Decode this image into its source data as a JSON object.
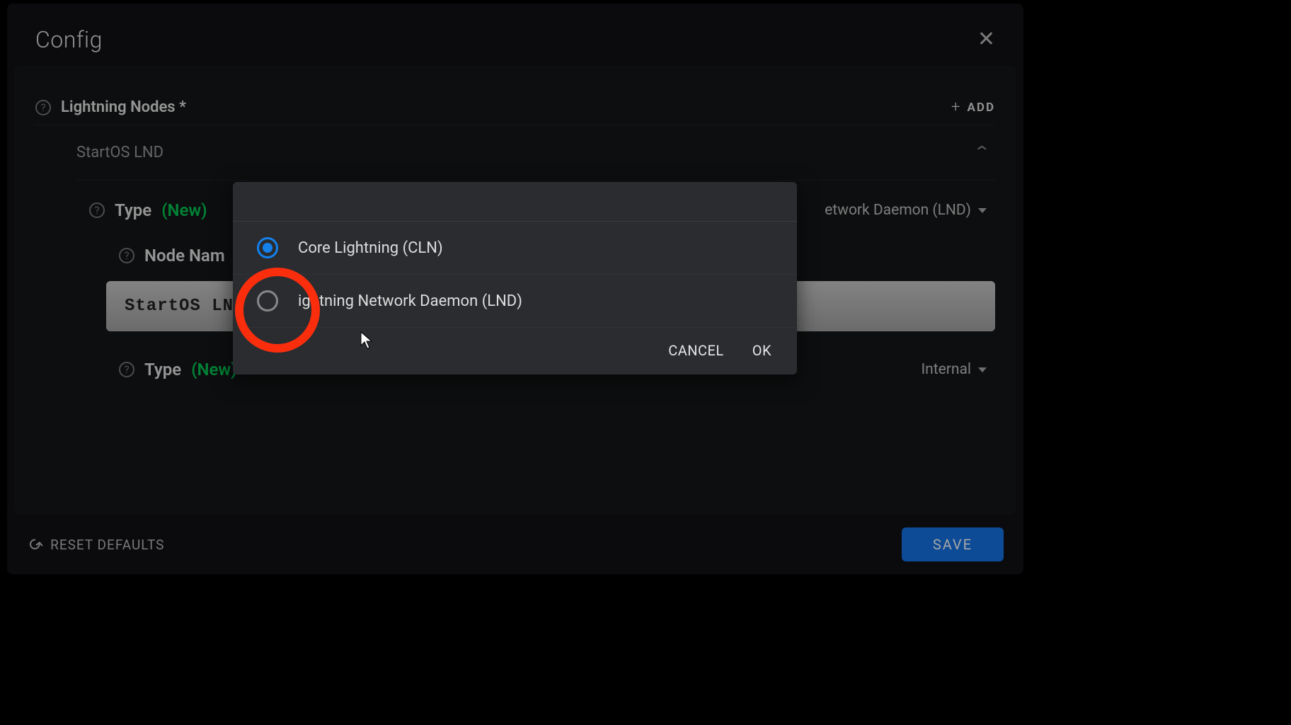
{
  "header": {
    "title": "Config"
  },
  "section": {
    "label": "Lightning Nodes *",
    "add_label": "ADD"
  },
  "node": {
    "name": "StartOS LND",
    "type_label": "Type",
    "new_tag": "(New)",
    "type_value": "etwork Daemon (LND)",
    "name_label": "Node Nam",
    "name_value": "StartOS LND",
    "sub_type_label": "Type",
    "sub_new_tag": "(New)",
    "sub_type_value": "Internal"
  },
  "popup": {
    "options": [
      {
        "label": "Core Lightning (CLN)",
        "selected": true
      },
      {
        "label": "Lightning Network Daemon (LND)",
        "selected": false
      }
    ],
    "cancel": "CANCEL",
    "ok": "OK",
    "option0": "Core Lightning (CLN)",
    "option1": "ightning Network Daemon (LND)"
  },
  "footer": {
    "reset": "RESET DEFAULTS",
    "save": "SAVE"
  }
}
